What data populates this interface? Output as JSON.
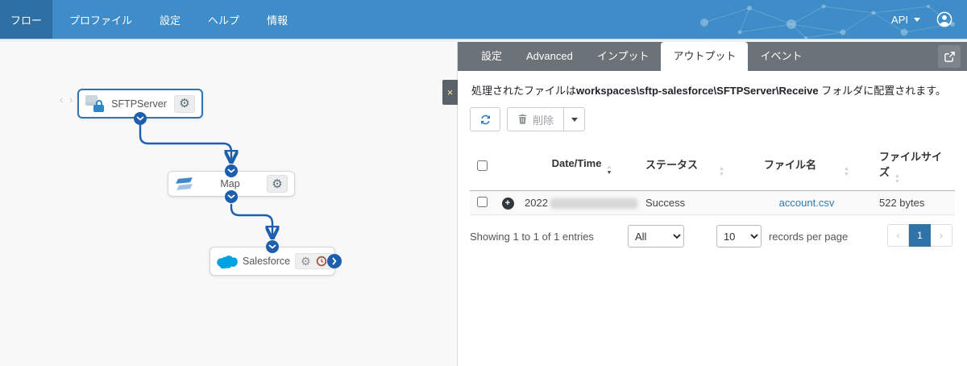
{
  "navbar": {
    "items": [
      {
        "label": "フロー",
        "active": true
      },
      {
        "label": "プロファイル",
        "active": false
      },
      {
        "label": "設定",
        "active": false
      },
      {
        "label": "ヘルプ",
        "active": false
      },
      {
        "label": "情報",
        "active": false
      }
    ],
    "api_label": "API"
  },
  "canvas": {
    "nodes": {
      "sftp": {
        "label": "SFTPServer"
      },
      "map": {
        "label": "Map"
      },
      "salesforce": {
        "label": "Salesforce"
      }
    }
  },
  "panel": {
    "tabs": [
      {
        "label": "設定",
        "active": false
      },
      {
        "label": "Advanced",
        "active": false
      },
      {
        "label": "インプット",
        "active": false
      },
      {
        "label": "アウトプット",
        "active": true
      },
      {
        "label": "イベント",
        "active": false
      }
    ],
    "info": {
      "prefix": "処理されたファイルは",
      "path": "workspaces\\sftp-salesforce\\SFTPServer\\Receive",
      "suffix": " フォルダに配置されます。"
    },
    "toolbar": {
      "delete_label": "削除"
    },
    "table": {
      "headers": [
        "Date/Time",
        "ステータス",
        "ファイル名",
        "ファイルサイズ"
      ],
      "rows": [
        {
          "date_prefix": "2022",
          "status": "Success",
          "filename": "account.csv",
          "filesize": "522 bytes"
        }
      ]
    },
    "footer": {
      "showing": "Showing 1 to 1 of 1 entries",
      "filter_value": "All",
      "page_size": "10",
      "records_label": "records per page",
      "pagination": {
        "prev": "‹",
        "page": "1",
        "next": "›"
      }
    }
  },
  "icons": {
    "gear": "⚙",
    "close": "×",
    "drag_handle": "‹ ›",
    "plus": "+",
    "sort_up": "▲",
    "sort_down": "▼"
  },
  "colors": {
    "navbar_bg": "#3e8dc8",
    "navbar_active_bg": "#2e70a4",
    "tabbar_bg": "#6c7378",
    "connector_blue": "#1d5fae",
    "node_selected_border": "#2e74b5",
    "link_blue": "#2e7cb8",
    "pagination_active": "#2e74a8",
    "salesforce_blue": "#00a1e0",
    "status_clock_red": "#a35242"
  }
}
